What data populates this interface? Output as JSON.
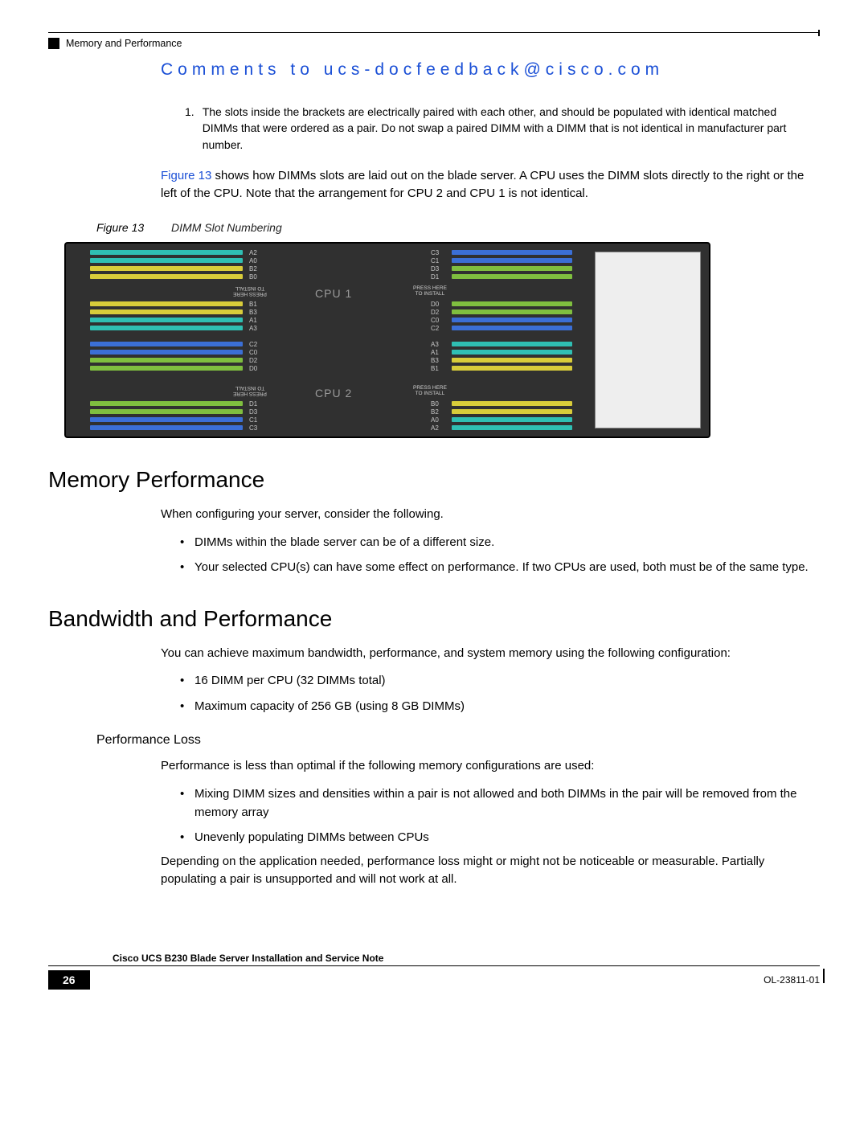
{
  "header": {
    "section_label": "Memory and Performance",
    "feedback": "Comments to ucs-docfeedback@cisco.com"
  },
  "notes": [
    {
      "num": "1.",
      "text": "The slots inside the brackets are electrically paired with each other, and should be populated with identical matched DIMMs that were ordered as a pair. Do not swap a paired DIMM with a DIMM that is not identical in manufacturer part number."
    }
  ],
  "intro": {
    "fig_ref": "Figure 13",
    "text_after_ref": " shows how DIMMs slots are laid out on the blade server. A CPU uses the DIMM slots directly to the right or the left of the CPU. Note that the arrangement for CPU 2 and CPU 1 is not identical."
  },
  "figure": {
    "caption_num": "Figure 13",
    "caption_title": "DIMM Slot Numbering",
    "image_id": "279986",
    "cpu1": "CPU 1",
    "cpu2": "CPU 2",
    "press": "PRESS HERE\nTO INSTALL",
    "left_top_labels": [
      "A2",
      "A0",
      "B2",
      "B0"
    ],
    "left_mid_labels": [
      "B1",
      "B3",
      "A1",
      "A3"
    ],
    "left_low1_labels": [
      "C2",
      "C0",
      "D2",
      "D0"
    ],
    "left_low2_labels": [
      "D1",
      "D3",
      "C1",
      "C3"
    ],
    "right_top_labels": [
      "C3",
      "C1",
      "D3",
      "D1"
    ],
    "right_mid_labels": [
      "D0",
      "D2",
      "C0",
      "C2"
    ],
    "right_low1_labels": [
      "A3",
      "A1",
      "B3",
      "B1"
    ],
    "right_low2_labels": [
      "B0",
      "B2",
      "A0",
      "A2"
    ]
  },
  "memory_perf": {
    "heading": "Memory Performance",
    "intro": "When configuring your server, consider the following.",
    "bullets": [
      "DIMMs within the blade server can be of a different size.",
      "Your selected CPU(s) can have some effect on performance. If two CPUs are used, both must be of the same type."
    ]
  },
  "bandwidth": {
    "heading": "Bandwidth and Performance",
    "intro": "You can achieve maximum bandwidth, performance, and system memory using the following configuration:",
    "bullets": [
      "16 DIMM per CPU (32 DIMMs total)",
      "Maximum capacity of 256 GB (using 8 GB DIMMs)"
    ],
    "loss_heading": "Performance Loss",
    "loss_intro": "Performance is less than optimal if the following memory configurations are used:",
    "loss_bullets": [
      "Mixing DIMM sizes and densities within a pair is not allowed and both DIMMs in the pair will be removed from the memory array",
      "Unevenly populating DIMMs between CPUs"
    ],
    "loss_outro": "Depending on the application needed, performance loss might or might not be noticeable or measurable. Partially populating a pair is unsupported and will not work at all."
  },
  "footer": {
    "doc_title": "Cisco UCS B230 Blade Server Installation and Service Note",
    "page": "26",
    "doc_id": "OL-23811-01"
  }
}
